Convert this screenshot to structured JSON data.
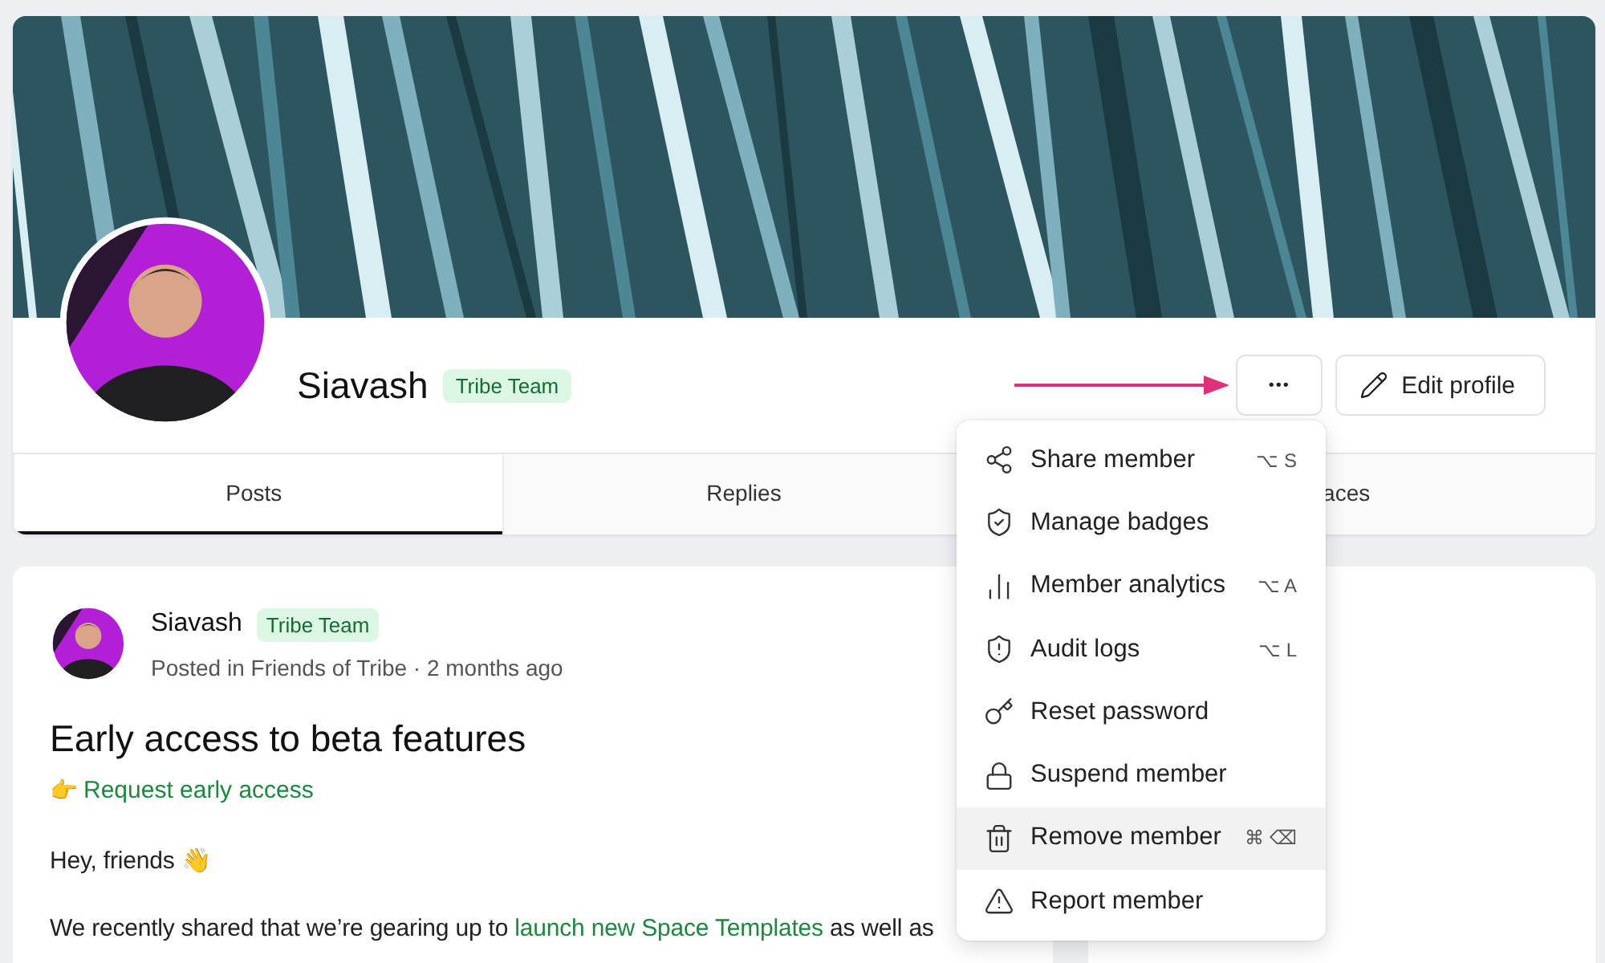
{
  "profile": {
    "name": "Siavash",
    "badge": "Tribe Team",
    "more_button": "•••",
    "edit_button": "Edit profile"
  },
  "tabs": [
    {
      "label": "Posts",
      "selected": true
    },
    {
      "label": "Replies",
      "selected": false
    },
    {
      "label": "aces",
      "selected": false
    }
  ],
  "menu": [
    {
      "label": "Share member",
      "shortcut": "⌥ S",
      "selected": false
    },
    {
      "label": "Manage badges",
      "selected": false
    },
    {
      "label": "Member analytics",
      "shortcut": "⌥ A",
      "selected": false
    },
    {
      "label": "Audit logs",
      "shortcut": "⌥ L",
      "selected": false
    },
    {
      "label": "Reset password",
      "selected": false
    },
    {
      "label": "Suspend member",
      "selected": false
    },
    {
      "label": "Remove member",
      "shortcut": "⌘ ⌫",
      "selected": true
    },
    {
      "label": "Report member",
      "selected": false
    }
  ],
  "post": {
    "author": "Siavash",
    "badge": "Tribe Team",
    "meta": "Posted in Friends of Tribe · 2 months ago",
    "title": "Early access to beta features",
    "cta_emoji": "👉",
    "cta": "Request early access",
    "greeting": "Hey, friends 👋",
    "body": {
      "before": "We recently shared that we’re gearing up to ",
      "link": "launch new Space Templates",
      "after": " as well as"
    }
  }
}
